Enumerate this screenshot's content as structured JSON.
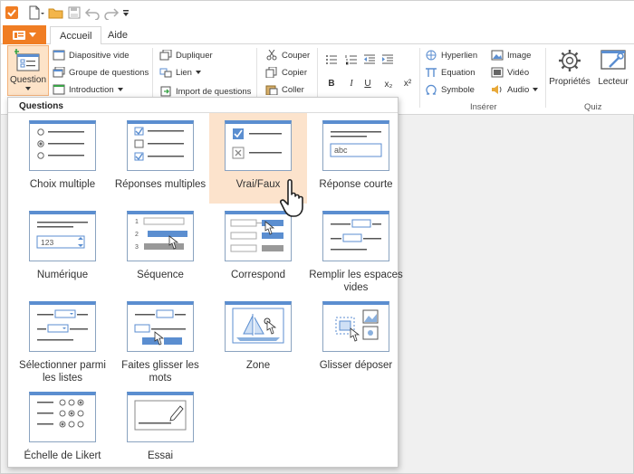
{
  "colors": {
    "accent": "#f07d23",
    "selected_bg": "#fce3cc",
    "thumb_header": "#5b8ed0"
  },
  "tabs": {
    "home": "Accueil",
    "help": "Aide"
  },
  "ribbon": {
    "question_label": "Question",
    "slide_items": [
      "Diapositive vide",
      "Groupe de questions",
      "Introduction"
    ],
    "edit_items": [
      "Dupliquer",
      "Lien",
      "Import de questions"
    ],
    "clipboard_items": [
      "Couper",
      "Copier",
      "Coller"
    ],
    "format_buttons": [
      "B",
      "I",
      "U",
      "x₂",
      "x²"
    ],
    "insert_items": [
      "Hyperlien",
      "Equation",
      "Symbole"
    ],
    "media_items": [
      "Image",
      "Vidéo",
      "Audio"
    ],
    "insert_group_label": "Insérer",
    "quiz_buttons": [
      "Propriétés",
      "Lecteur"
    ],
    "quiz_group_label": "Quiz"
  },
  "panel": {
    "title": "Questions",
    "items": [
      "Choix multiple",
      "Réponses multiples",
      "Vrai/Faux",
      "Réponse courte",
      "Numérique",
      "Séquence",
      "Correspond",
      "Remplir les espaces vides",
      "Sélectionner parmi les listes",
      "Faites glisser les mots",
      "Zone",
      "Glisser déposer",
      "Échelle de Likert",
      "Essai"
    ],
    "thumb_text": {
      "abc": "abc",
      "num": "123",
      "seq": [
        "1",
        "2",
        "3"
      ]
    },
    "selected": "Vrai/Faux"
  }
}
